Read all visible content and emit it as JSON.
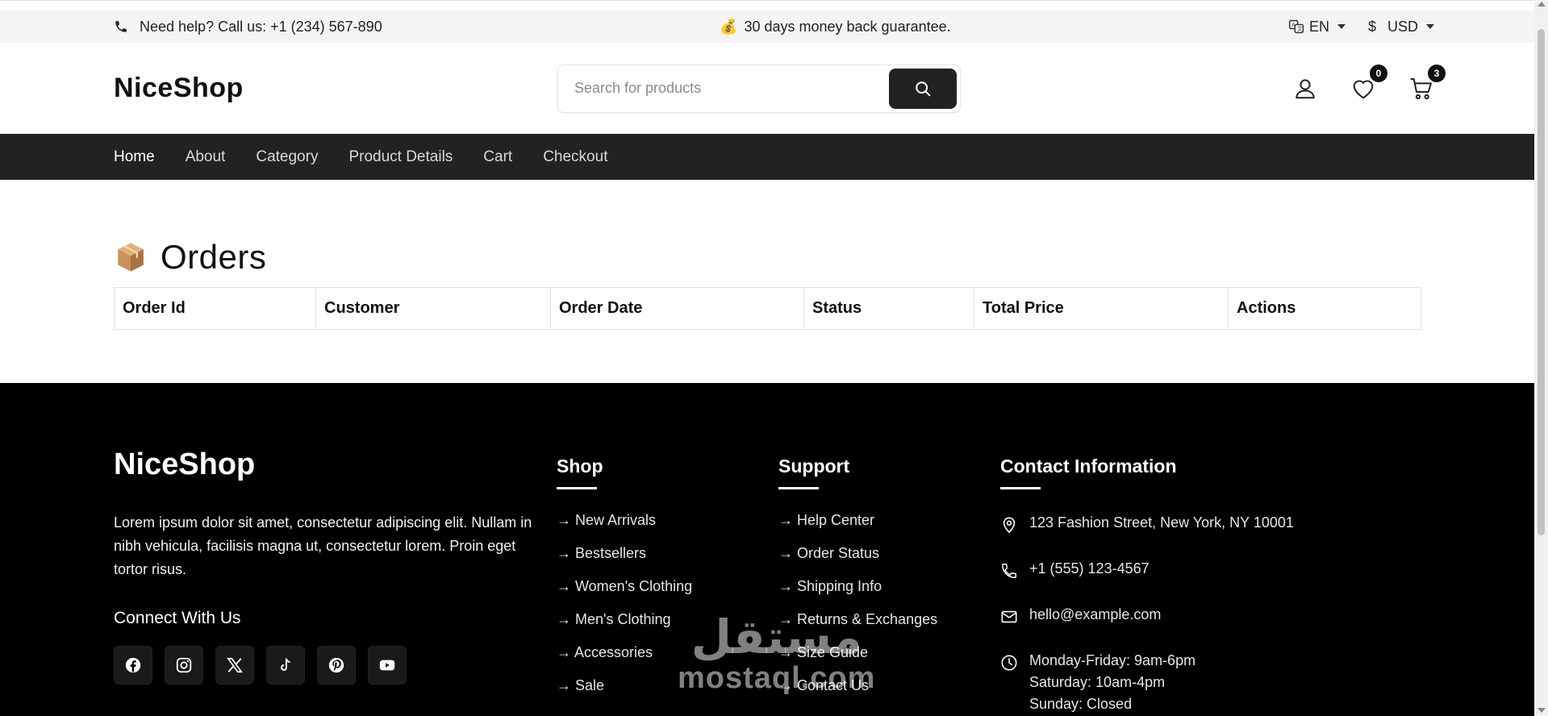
{
  "topbar": {
    "help_text": "Need help? Call us: +1 (234) 567-890",
    "promo_emoji": "💰",
    "promo_text": "30 days money back guarantee.",
    "language": "EN",
    "currency_symbol": "$",
    "currency": "USD"
  },
  "header": {
    "logo": "NiceShop",
    "search_placeholder": "Search for products",
    "wishlist_count": "0",
    "cart_count": "3"
  },
  "nav": {
    "items": [
      "Home",
      "About",
      "Category",
      "Product Details",
      "Cart",
      "Checkout"
    ],
    "active": "Home"
  },
  "main": {
    "title_emoji": "📦",
    "title": "Orders",
    "columns": [
      "Order Id",
      "Customer",
      "Order Date",
      "Status",
      "Total Price",
      "Actions"
    ]
  },
  "footer": {
    "logo": "NiceShop",
    "description": "Lorem ipsum dolor sit amet, consectetur adipiscing elit. Nullam in nibh vehicula, facilisis magna ut, consectetur lorem. Proin eget tortor risus.",
    "connect_heading": "Connect With Us",
    "socials": [
      "facebook-icon",
      "instagram-icon",
      "x-icon",
      "tiktok-icon",
      "pinterest-icon",
      "youtube-icon"
    ],
    "shop": {
      "heading": "Shop",
      "links": [
        "→ New Arrivals",
        "→ Bestsellers",
        "→ Women's Clothing",
        "→ Men's Clothing",
        "→ Accessories",
        "→ Sale"
      ]
    },
    "support": {
      "heading": "Support",
      "links": [
        "→ Help Center",
        "→ Order Status",
        "→ Shipping Info",
        "→ Returns & Exchanges",
        "→ Size Guide",
        "→ Contact Us"
      ]
    },
    "contact": {
      "heading": "Contact Information",
      "address": "123 Fashion Street, New York, NY 10001",
      "phone": "+1 (555) 123-4567",
      "email": "hello@example.com",
      "hours_1": "Monday-Friday: 9am-6pm",
      "hours_2": "Saturday: 10am-4pm",
      "hours_3": "Sunday: Closed"
    }
  },
  "watermark": {
    "arabic": "مستقل",
    "latin": "mostaql.com"
  },
  "colors": {
    "nav_bg": "#232222",
    "footer_bg": "#000000",
    "topbar_bg": "#f4f4f4",
    "button_dark": "#222222"
  }
}
